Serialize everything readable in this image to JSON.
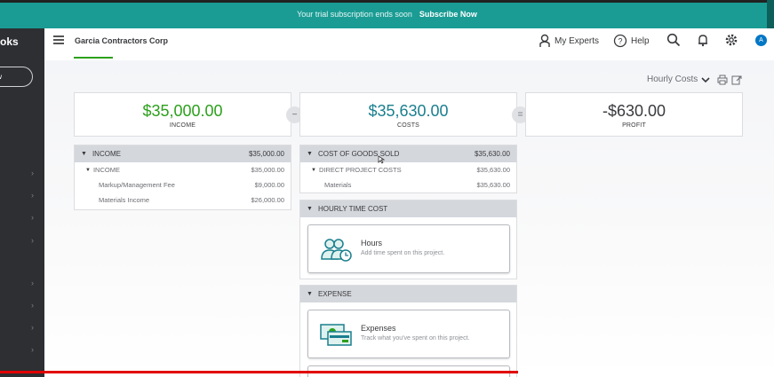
{
  "banner": {
    "text": "Your trial subscription ends soon",
    "cta": "Subscribe Now"
  },
  "sidebar": {
    "brand": "oks",
    "new_label": "w",
    "chevron": "›"
  },
  "header": {
    "company": "Garcia Contractors Corp",
    "my_experts": "My Experts",
    "help": "Help",
    "avatar_initial": "A"
  },
  "toolbar": {
    "view_label": "Hourly Costs"
  },
  "summary": {
    "income": {
      "amount": "$35,000.00",
      "label": "INCOME"
    },
    "costs": {
      "amount": "$35,630.00",
      "label": "COSTS"
    },
    "profit": {
      "amount": "-$630.00",
      "label": "PROFIT"
    },
    "minus": "−",
    "equals": "="
  },
  "income_panel": {
    "title": "INCOME",
    "total": "$35,000.00",
    "group": {
      "label": "INCOME",
      "value": "$35,000.00"
    },
    "items": [
      {
        "label": "Markup/Management Fee",
        "value": "$9,000.00"
      },
      {
        "label": "Materials Income",
        "value": "$26,000.00"
      }
    ]
  },
  "cogs_panel": {
    "title": "COST OF GOODS SOLD",
    "total": "$35,630.00",
    "group": {
      "label": "DIRECT PROJECT COSTS",
      "value": "$35,630.00"
    },
    "items": [
      {
        "label": "Materials",
        "value": "$35,630.00"
      }
    ]
  },
  "hourly_panel": {
    "title": "HOURLY TIME COST",
    "card": {
      "title": "Hours",
      "subtitle": "Add time spent on this project."
    }
  },
  "expense_panel": {
    "title": "EXPENSE",
    "card": {
      "title": "Expenses",
      "subtitle": "Track what you've spent on this project."
    }
  },
  "colors": {
    "banner": "#1a9c94",
    "income": "#2ca01c",
    "costs": "#1a7f8e",
    "profit": "#393a3d",
    "sidebar": "#2d2f33"
  }
}
